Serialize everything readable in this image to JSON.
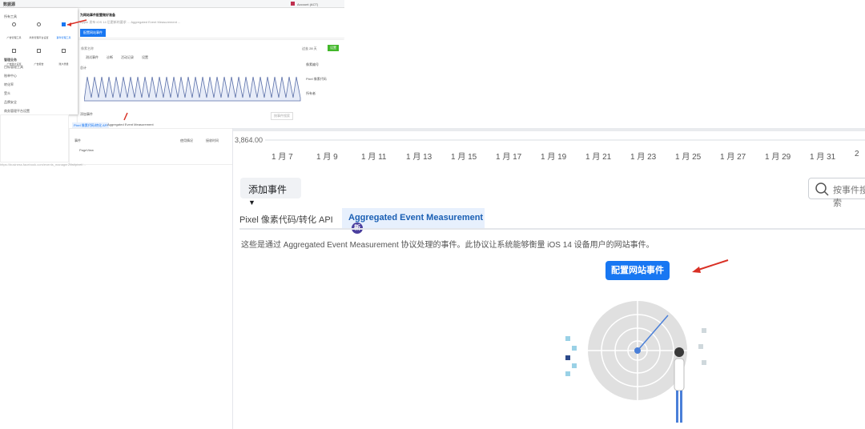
{
  "inset": {
    "topbar_title": "数据源",
    "account": "Account (ACT)",
    "menu_heading": "所有工具",
    "menu_tiles": [
      "广告管理工具",
      "商务管理平台设置",
      "事件管理工具",
      "广告账户设置",
      "广告报告",
      "账户质量"
    ],
    "menu_section": "管理业务",
    "menu_items": [
      "目标管理工具",
      "账单中心",
      "转化率",
      "受众",
      "品牌安全",
      "商务管理平台设置"
    ],
    "banner_title": "为网站事件配置做好准备",
    "banner_text": "Apple 发布 iOS 14 后更新的要求 ... Aggregated Event Measurement ...",
    "banner_button": "配置网站事件",
    "pixel_name": "像素名称",
    "tabs": [
      "概览",
      "测试事件",
      "诊断",
      "活动记录",
      "设置"
    ],
    "date_button": "过去 28 天",
    "action_button": "设置",
    "chart_label": "总计",
    "side_items": [
      "像素编号",
      "Pixel 像素代码",
      "所有者"
    ],
    "add_event": "添加事件",
    "tab_pixel": "Pixel 像素代码/转化 API",
    "tab_aem": "Aggregated Event Measurement",
    "col_headers": [
      "事件",
      "",
      "使用情况",
      "接收时间"
    ],
    "row_event": "PageView",
    "search_placeholder": "按事件搜索",
    "url": "https://business.facebook.com/events_manager2/list/pixel/..."
  },
  "main": {
    "value_label": "3,864.00",
    "dates": [
      "1 月 7",
      "1 月 9",
      "1 月 11",
      "1 月 13",
      "1 月 15",
      "1 月 17",
      "1 月 19",
      "1 月 21",
      "1 月 23",
      "1 月 25",
      "1 月 27",
      "1 月 29",
      "1 月 31",
      "2"
    ],
    "add_event_button": "添加事件",
    "search_placeholder": "按事件搜索",
    "tab_pixel": "Pixel 像素代码/转化 API",
    "tab_aem": "Aggregated Event Measurement",
    "new_badge": "新",
    "description": "这些是通过 Aggregated Event Measurement 协议处理的事件。此协议让系统能够衡量 iOS 14 设备用户的网站事件。",
    "configure_button": "配置网站事件"
  },
  "colors": {
    "accent": "#1877f2",
    "badge": "#4b3f9e",
    "arrow": "#d93025",
    "green": "#42b72a"
  }
}
